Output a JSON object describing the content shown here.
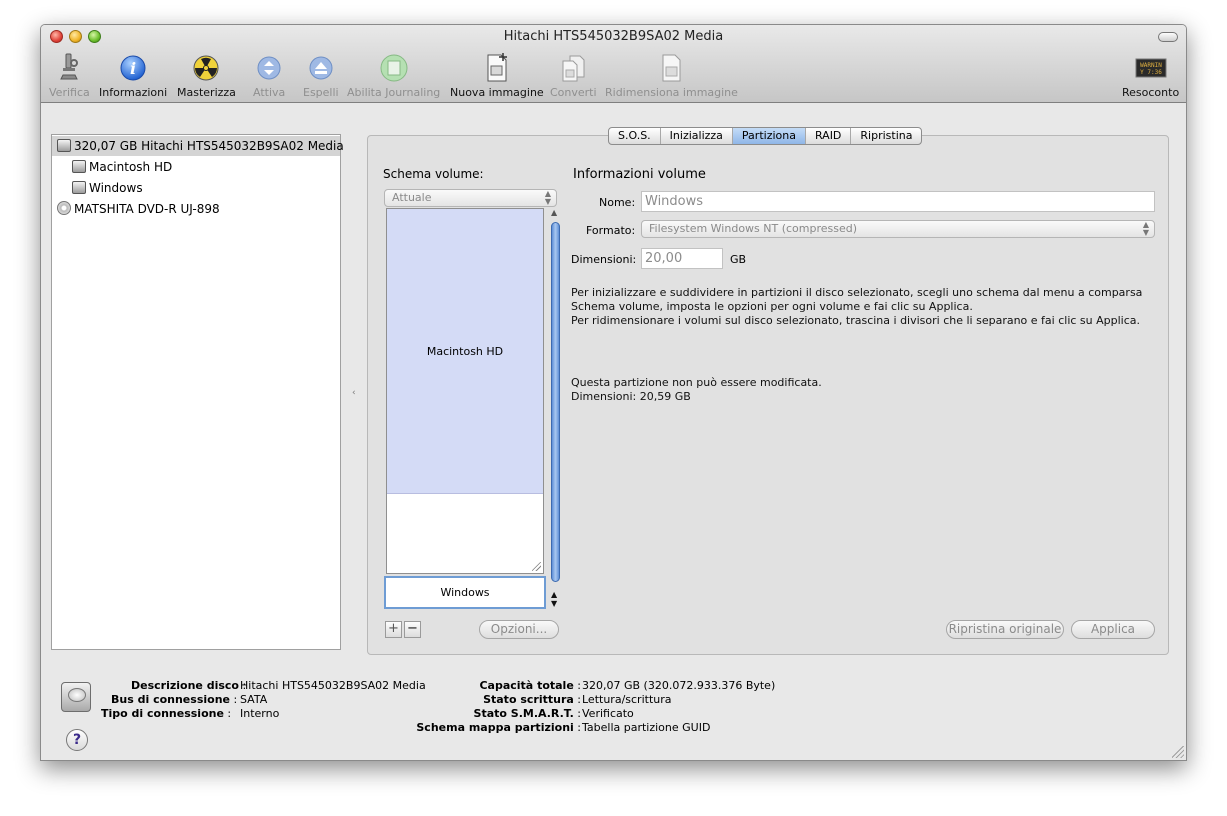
{
  "window": {
    "title": "Hitachi HTS545032B9SA02 Media"
  },
  "toolbar": {
    "items": [
      {
        "label": "Verifica",
        "icon": "microscope-icon",
        "enabled": false
      },
      {
        "label": "Informazioni",
        "icon": "info-icon",
        "enabled": true
      },
      {
        "label": "Masterizza",
        "icon": "burn-icon",
        "enabled": true
      },
      {
        "label": "Attiva",
        "icon": "mount-icon",
        "enabled": false
      },
      {
        "label": "Espelli",
        "icon": "eject-icon",
        "enabled": false
      },
      {
        "label": "Abilita Journaling",
        "icon": "journaling-icon",
        "enabled": false
      },
      {
        "label": "Nuova immagine",
        "icon": "new-image-icon",
        "enabled": true
      },
      {
        "label": "Converti",
        "icon": "convert-icon",
        "enabled": false
      },
      {
        "label": "Ridimensiona immagine",
        "icon": "resize-image-icon",
        "enabled": false
      },
      {
        "label": "Resoconto",
        "icon": "log-icon",
        "enabled": true
      }
    ],
    "log_icon_text": "WARNIN\nY 7:36"
  },
  "sidebar": {
    "items": [
      {
        "label": "320,07 GB Hitachi HTS545032B9SA02 Media",
        "icon": "disk-icon",
        "selected": true
      },
      {
        "label": "Macintosh HD",
        "icon": "volume-icon",
        "selected": false
      },
      {
        "label": "Windows",
        "icon": "volume-icon",
        "selected": false
      },
      {
        "label": "MATSHITA DVD-R UJ-898",
        "icon": "optical-drive-icon",
        "selected": false
      }
    ]
  },
  "tabs": [
    "S.O.S.",
    "Inizializza",
    "Partiziona",
    "RAID",
    "Ripristina"
  ],
  "active_tab": "Partiziona",
  "partition": {
    "schema_label": "Schema volume:",
    "schema_value": "Attuale",
    "partitions": [
      {
        "name": "Macintosh HD"
      },
      {
        "name": "Windows"
      }
    ],
    "add_label": "+",
    "remove_label": "−",
    "options_button": "Opzioni...",
    "info_title": "Informazioni volume",
    "name_label": "Nome:",
    "name_value": "Windows",
    "format_label": "Formato:",
    "format_value": "Filesystem Windows NT (compressed)",
    "size_label": "Dimensioni:",
    "size_value": "20,00",
    "size_unit": "GB",
    "help_line1": "Per inizializzare e suddividere in partizioni il disco selezionato, scegli uno schema dal menu a comparsa",
    "help_line2": "Schema volume, imposta le opzioni per ogni volume e fai clic su Applica.",
    "help_line3": "Per ridimensionare i volumi sul disco selezionato, trascina i divisori che li separano e fai clic su Applica.",
    "note_line1": "Questa partizione non può essere modificata.",
    "note_line2": "Dimensioni: 20,59 GB",
    "revert_button": "Ripristina originale",
    "apply_button": "Applica"
  },
  "details": {
    "left": [
      {
        "key": "Descrizione disco",
        "value": "Hitachi HTS545032B9SA02 Media"
      },
      {
        "key": "Bus di connessione",
        "value": "SATA"
      },
      {
        "key": "Tipo di connessione",
        "value": "Interno"
      }
    ],
    "right": [
      {
        "key": "Capacità totale",
        "value": "320,07 GB (320.072.933.376 Byte)"
      },
      {
        "key": "Stato scrittura",
        "value": "Lettura/scrittura"
      },
      {
        "key": "Stato S.M.A.R.T.",
        "value": "Verificato"
      },
      {
        "key": "Schema mappa partizioni",
        "value": "Tabella partizione GUID"
      }
    ],
    "help_label": "?"
  }
}
